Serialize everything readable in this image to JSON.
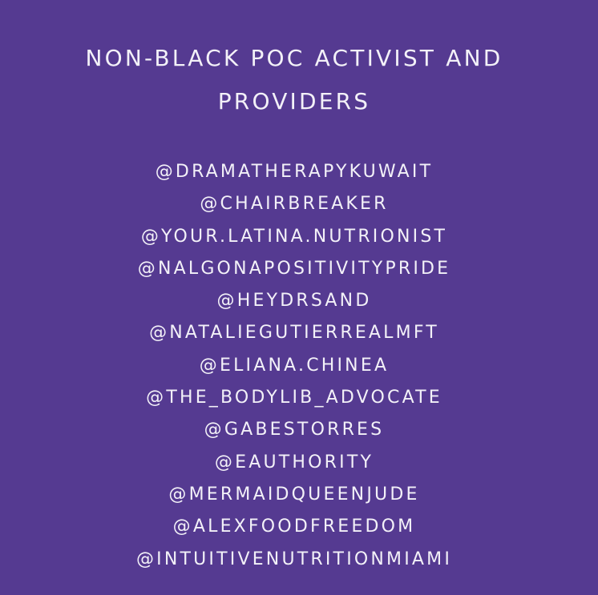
{
  "background_color": "#553a91",
  "text_color": "#f3f1f8",
  "title": {
    "line1": "NON-BLACK POC ACTIVIST AND",
    "line2": "PROVIDERS"
  },
  "handles": [
    "@DRAMATHERAPYKUWAIT",
    "@CHAIRBREAKER",
    "@YOUR.LATINA.NUTRIONIST",
    "@NALGONAPOSITIVITYPRIDE",
    "@HEYDRSAND",
    "@NATALIEGUTIERREALMFT",
    "@ELIANA.CHINEA",
    "@THE_BODYLIB_ADVOCATE",
    "@GABESTORRES",
    "@EAUTHORITY",
    "@MERMAIDQUEENJUDE",
    "@ALEXFOODFREEDOM",
    "@INTUITIVENUTRITIONMIAMI"
  ]
}
